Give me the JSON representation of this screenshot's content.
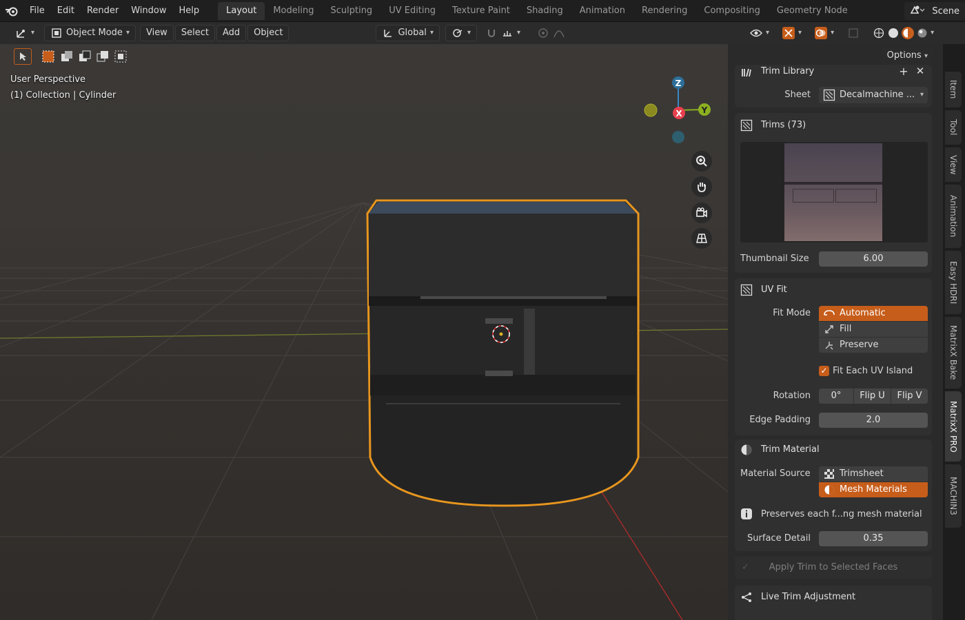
{
  "menu": {
    "items": [
      "File",
      "Edit",
      "Render",
      "Window",
      "Help"
    ]
  },
  "workspaces": {
    "tabs": [
      "Layout",
      "Modeling",
      "Sculpting",
      "UV Editing",
      "Texture Paint",
      "Shading",
      "Animation",
      "Rendering",
      "Compositing",
      "Geometry Node"
    ],
    "active": "Layout"
  },
  "scene": {
    "name": "Scene"
  },
  "header": {
    "mode": "Object Mode",
    "menus": [
      "View",
      "Select",
      "Add",
      "Object"
    ],
    "orientation": "Global",
    "options": "Options"
  },
  "viewport": {
    "perspective": "User Perspective",
    "collection": "(1) Collection | Cylinder",
    "gizmo": {
      "x": "X",
      "y": "Y",
      "z": "Z"
    }
  },
  "sidebar": {
    "trim_library": {
      "title": "Trim Library",
      "sheet_label": "Sheet",
      "sheet_value": "Decalmachine ..."
    },
    "trims": {
      "title": "Trims (73)",
      "thumb_size_label": "Thumbnail Size",
      "thumb_size_value": "6.00"
    },
    "uv_fit": {
      "title": "UV Fit",
      "fit_mode_label": "Fit Mode",
      "fit_modes": [
        "Automatic",
        "Fill",
        "Preserve"
      ],
      "fit_mode_active": "Automatic",
      "fit_each_label": "Fit Each UV Island",
      "fit_each_checked": true,
      "rotation_label": "Rotation",
      "rotation_value": "0°",
      "flip_u": "Flip U",
      "flip_v": "Flip V",
      "edge_padding_label": "Edge Padding",
      "edge_padding_value": "2.0"
    },
    "trim_material": {
      "title": "Trim Material",
      "source_label": "Material Source",
      "sources": [
        "Trimsheet",
        "Mesh Materials"
      ],
      "source_active": "Mesh Materials",
      "info": "Preserves each f...ng mesh material",
      "surface_label": "Surface Detail",
      "surface_value": "0.35"
    },
    "apply_button": "Apply Trim to Selected Faces",
    "live_trim": {
      "title": "Live Trim Adjustment"
    }
  },
  "vertical_tabs": [
    "Item",
    "Tool",
    "View",
    "Animation",
    "Easy HDRI",
    "MatrixX Bake",
    "MatrixX PRO",
    "MACHIN3"
  ],
  "vertical_tab_active": "MatrixX PRO",
  "colors": {
    "accent": "#c65d1a",
    "selection_outline": "#e8961e",
    "axis_x": "#e8404e",
    "axis_y": "#8cb020",
    "axis_z": "#3a88c8"
  }
}
